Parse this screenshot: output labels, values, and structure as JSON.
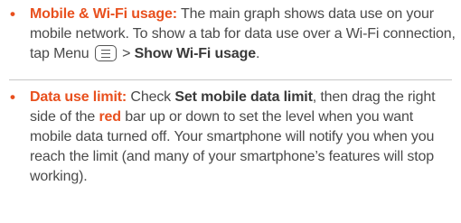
{
  "items": [
    {
      "term": "Mobile & Wi-Fi usage:",
      "text1": " The main graph shows data use on your mobile network. To show a tab for data use over a Wi-Fi connection, tap Menu ",
      "menu_icon": "menu-icon",
      "text2": " > ",
      "bold1": "Show Wi-Fi usage",
      "text3": "."
    },
    {
      "term": "Data use limit:",
      "text1": " Check ",
      "bold1": "Set mobile data limit",
      "text2": ", then drag the right side of the ",
      "red_word": "red",
      "text3": " bar up or down to set the level when you want mobile data turned off. Your smartphone will notify you when you reach the limit (and many of your smartphone’s features will stop working)."
    }
  ],
  "bullet": "•",
  "colors": {
    "accent": "#e8501e",
    "text": "#4a4a4a"
  }
}
